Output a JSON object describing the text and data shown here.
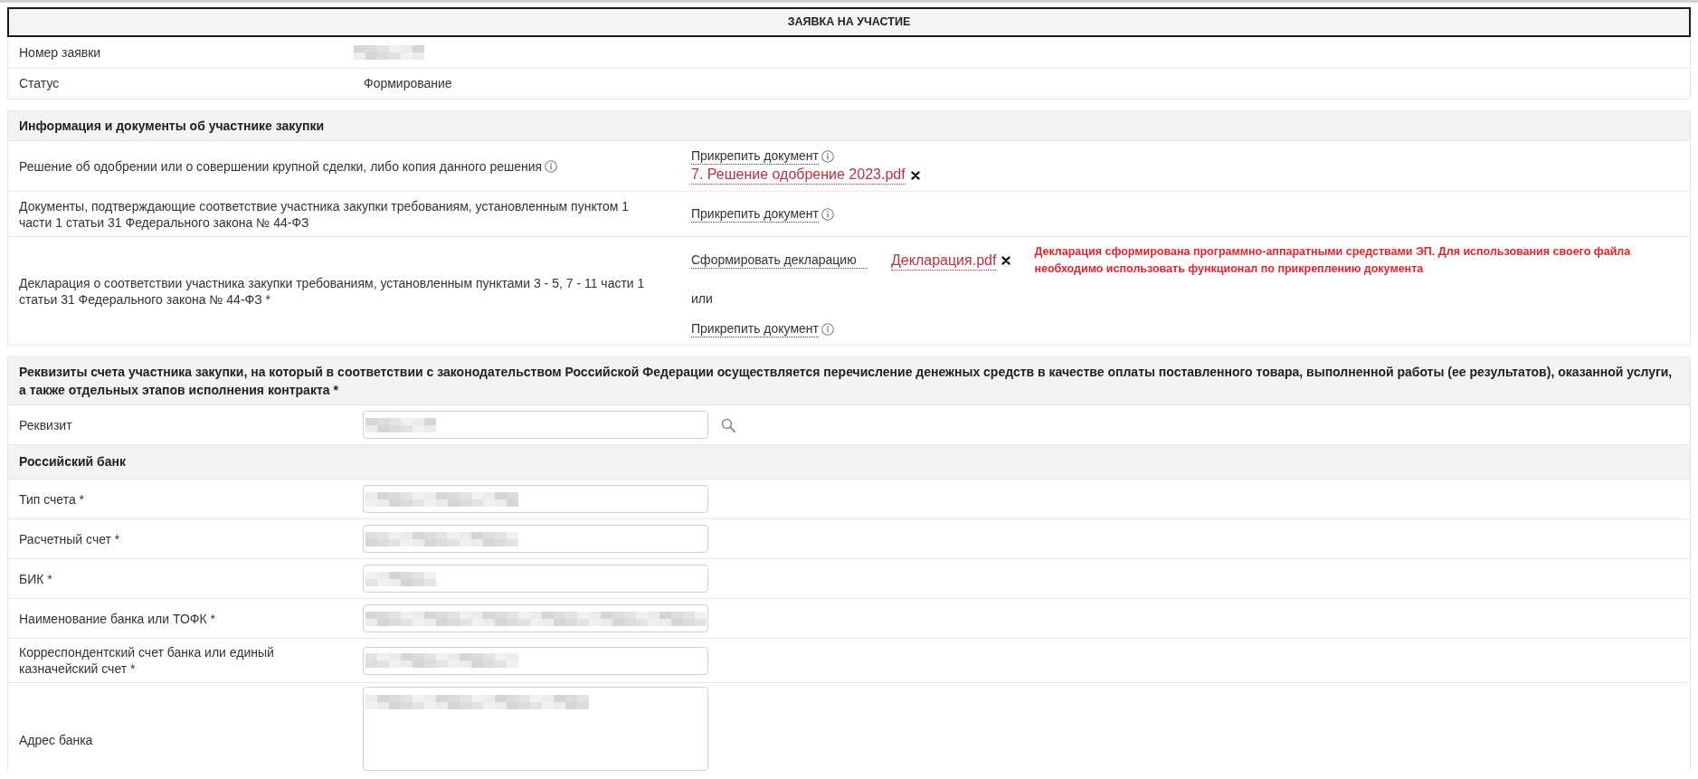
{
  "title": "ЗАЯВКА НА УЧАСТИЕ",
  "summary": [
    {
      "label": "Номер заявки",
      "redacted": true
    },
    {
      "label": "Статус",
      "value": "Формирование",
      "redacted": false
    }
  ],
  "participant_section": {
    "title": "Информация и документы об участнике закупки",
    "rows": [
      {
        "label": "Решение об одобрении или о совершении крупной сделки, либо копия данного решения",
        "info": true,
        "actions": [
          {
            "kind": "attach",
            "text": "Прикрепить документ",
            "info": true,
            "files": [
              "7. Решение одобрение 2023.pdf"
            ]
          }
        ]
      },
      {
        "label": "Документы, подтверждающие соответствие участника закупки требованиям, установленным пунктом 1 части 1 статьи 31 Федерального закона № 44-ФЗ",
        "info": false,
        "actions": [
          {
            "kind": "attach",
            "text": "Прикрепить документ",
            "info": true
          }
        ]
      },
      {
        "label": "Декларация о соответствии участника закупки требованиям, установленным пунктами 3 - 5, 7 - 11 части 1 статьи 31 Федерального закона № 44-ФЗ *",
        "info": false,
        "actions": [
          {
            "kind": "generate",
            "text": "Сформировать декларацию",
            "info": false,
            "file": "Декларация.pdf",
            "note": "Декларация сформирована программно-аппаратными средствами ЭП. Для использования своего файла необходимо использовать функционал по прикреплению документа"
          },
          {
            "kind": "text",
            "text": "или"
          },
          {
            "kind": "attach",
            "text": "Прикрепить документ",
            "info": true
          }
        ]
      }
    ]
  },
  "bank_section": {
    "title": "Реквизиты счета участника закупки, на который в соответствии с законодательством Российской Федерации осуществляется перечисление денежных средств в качестве оплаты поставленного товара, выполненной работы (ее результатов), оказанной услуги, а также отдельных этапов исполнения контракта *",
    "rows": [
      {
        "kind": "field",
        "label": "Реквизит",
        "redacted": true,
        "search": true
      },
      {
        "kind": "subheader",
        "label": "Российский банк"
      },
      {
        "kind": "field",
        "label": "Тип счета *",
        "redacted": true,
        "search": false
      },
      {
        "kind": "field",
        "label": "Расчетный счет *",
        "redacted": true,
        "search": false
      },
      {
        "kind": "field",
        "label": "БИК *",
        "redacted": true,
        "search": false
      },
      {
        "kind": "field",
        "label": "Наименование банка или ТОФК *",
        "redacted": true,
        "search": false
      },
      {
        "kind": "field",
        "label": "Корреспондентский счет банка или единый казначейский счет *",
        "redacted": true,
        "search": false
      },
      {
        "kind": "textarea",
        "label": "Адрес банка",
        "redacted": true
      }
    ]
  }
}
